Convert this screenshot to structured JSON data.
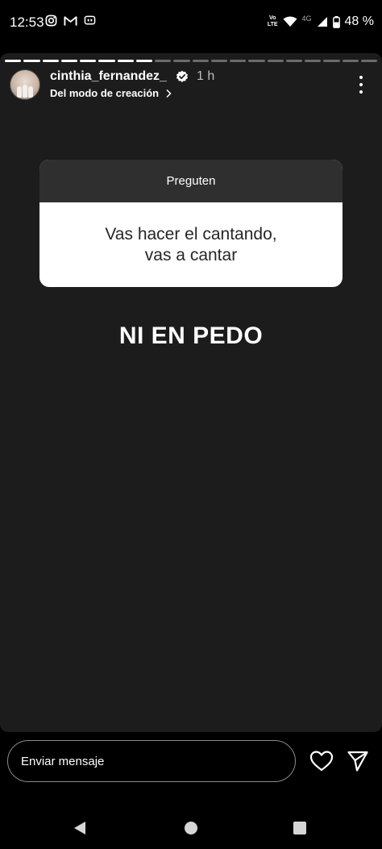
{
  "status_bar": {
    "time": "12:53",
    "left_icons": [
      "instagram-icon",
      "gmail-icon",
      "messages-icon"
    ],
    "volte_label": "Vo\nLTE",
    "network_label": "4G",
    "battery_percent": "48 %"
  },
  "story": {
    "progress": {
      "total_segments": 20,
      "completed_segments": 8
    },
    "username": "cinthia_fernandez_",
    "time_ago": "1 h",
    "subtitle": "Del modo de creación",
    "question_header": "Preguten",
    "question_text": "Vas hacer el cantando, vas a cantar",
    "answer_text": "NI EN PEDO"
  },
  "reply": {
    "placeholder": "Enviar mensaje"
  },
  "colors": {
    "background": "#000000",
    "story_background": "#1c1c1c",
    "question_header_bg": "#2f2f2f",
    "question_body_bg": "#ffffff"
  }
}
